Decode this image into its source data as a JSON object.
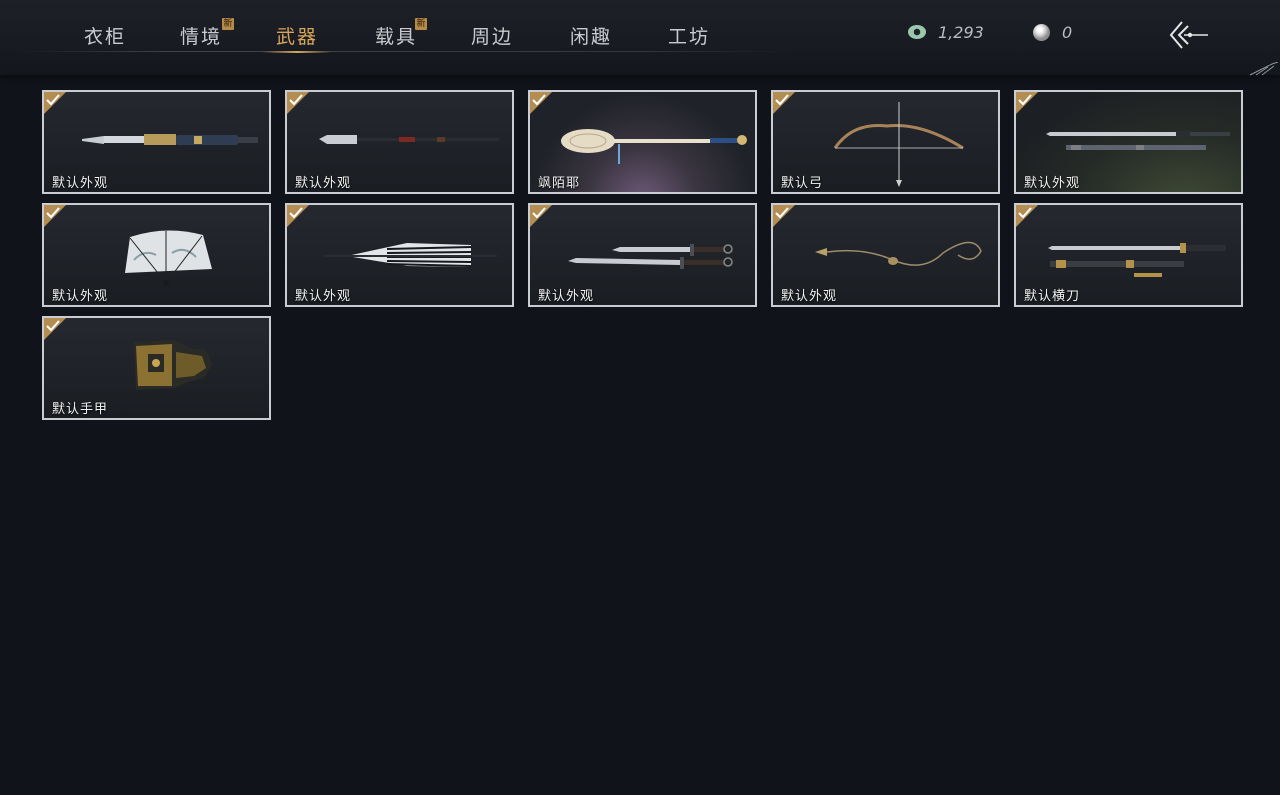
{
  "tabs": [
    {
      "label": "衣柜",
      "new": false,
      "active": false
    },
    {
      "label": "情境",
      "new": true,
      "active": false
    },
    {
      "label": "武器",
      "new": false,
      "active": true
    },
    {
      "label": "载具",
      "new": true,
      "active": false
    },
    {
      "label": "周边",
      "new": false,
      "active": false
    },
    {
      "label": "闲趣",
      "new": false,
      "active": false
    },
    {
      "label": "工坊",
      "new": false,
      "active": false
    }
  ],
  "new_badge": "新",
  "currency": {
    "jade_amount": "1,293",
    "pearl_amount": "0"
  },
  "items": [
    {
      "label": "默认外观",
      "icon": "spear-icon",
      "owned": true
    },
    {
      "label": "默认外观",
      "icon": "glaive-icon",
      "owned": true
    },
    {
      "label": "飒陌耶",
      "icon": "scepter-icon",
      "owned": true
    },
    {
      "label": "默认弓",
      "icon": "bow-icon",
      "owned": true
    },
    {
      "label": "默认外观",
      "icon": "twin-swords-icon",
      "owned": true
    },
    {
      "label": "默认外观",
      "icon": "fan-icon",
      "owned": true
    },
    {
      "label": "默认外观",
      "icon": "umbrella-icon",
      "owned": true
    },
    {
      "label": "默认外观",
      "icon": "dual-blades-icon",
      "owned": true
    },
    {
      "label": "默认外观",
      "icon": "rope-dart-icon",
      "owned": true
    },
    {
      "label": "默认横刀",
      "icon": "hengdao-icon",
      "owned": true
    },
    {
      "label": "默认手甲",
      "icon": "gauntlet-icon",
      "owned": true
    }
  ],
  "colors": {
    "accent": "#d9a55a",
    "background": "#10141a",
    "card_border": "#c9cdd2"
  }
}
